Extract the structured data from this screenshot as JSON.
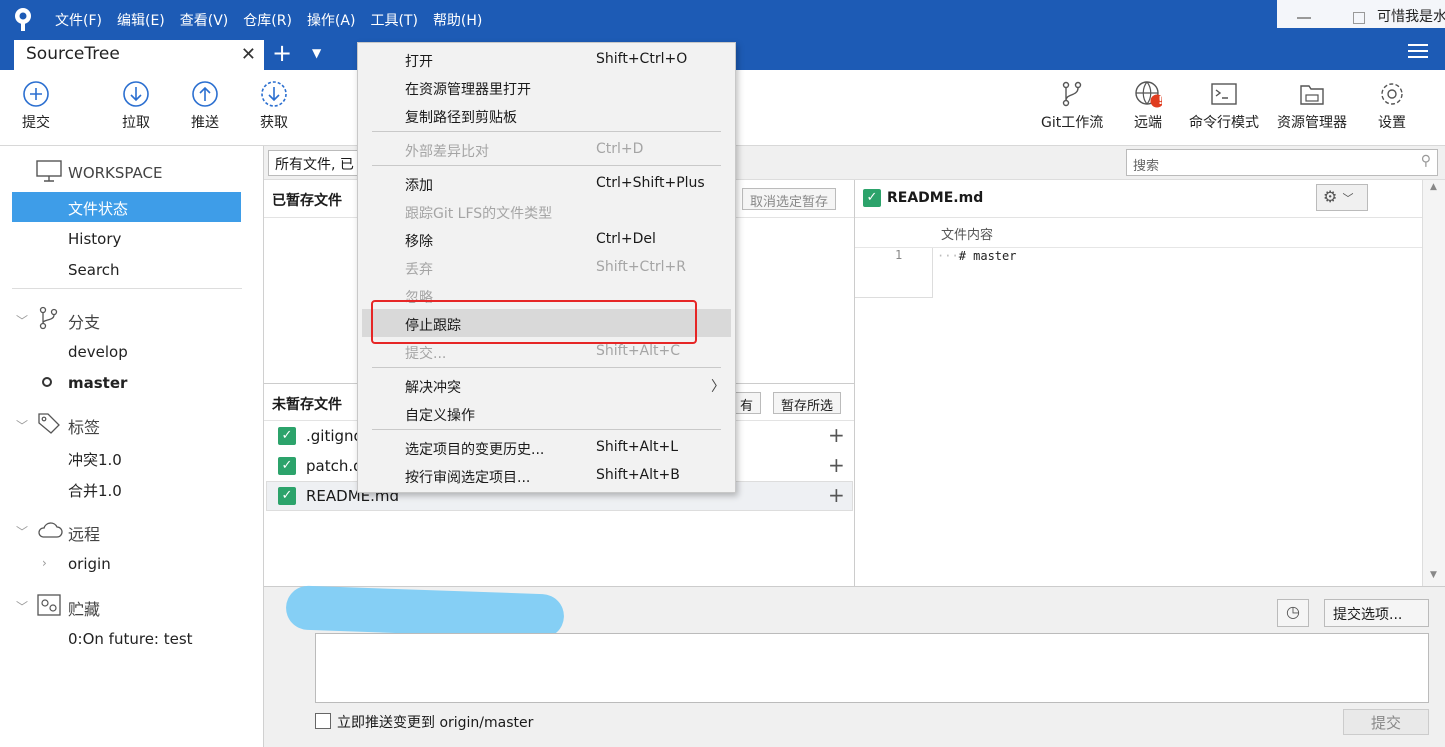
{
  "menubar": {
    "items": [
      "文件(F)",
      "编辑(E)",
      "查看(V)",
      "仓库(R)",
      "操作(A)",
      "工具(T)",
      "帮助(H)"
    ],
    "external_window_title": "可惜我是水"
  },
  "tab": {
    "label": "SourceTree",
    "close": "✕"
  },
  "toolbar": {
    "left": [
      {
        "label": "提交",
        "icon": "plus-circle-icon"
      },
      {
        "label": "拉取",
        "icon": "arrow-down-circle-icon"
      },
      {
        "label": "推送",
        "icon": "arrow-up-circle-icon"
      },
      {
        "label": "获取",
        "icon": "fetch-dashed-circle-icon"
      }
    ],
    "right": [
      {
        "label": "Git工作流",
        "icon": "git-flow-icon"
      },
      {
        "label": "远端",
        "icon": "globe-icon"
      },
      {
        "label": "命令行模式",
        "icon": "terminal-icon"
      },
      {
        "label": "资源管理器",
        "icon": "folder-icon"
      },
      {
        "label": "设置",
        "icon": "gear-icon"
      }
    ],
    "remote_alert": "!"
  },
  "sidebar": {
    "workspace": "WORKSPACE",
    "workspace_items": [
      "文件状态",
      "History",
      "Search"
    ],
    "branches": {
      "title": "分支",
      "items": [
        "develop",
        "master"
      ],
      "current": "master"
    },
    "tags": {
      "title": "标签",
      "items": [
        "冲突1.0",
        "合并1.0"
      ]
    },
    "remotes": {
      "title": "远程",
      "items": [
        "origin"
      ]
    },
    "stashes": {
      "title": "贮藏",
      "items": [
        "0:On future: test"
      ]
    }
  },
  "filter": {
    "dropdown": "所有文件, 已",
    "search_placeholder": "搜索"
  },
  "staged": {
    "title": "已暂存文件",
    "unstage_selected": "取消选定暂存"
  },
  "unstaged": {
    "title": "未暂存文件",
    "stage_all_partial": "有",
    "stage_selected": "暂存所选",
    "files": [
      ".gitignore",
      "patch.d",
      "README.md"
    ]
  },
  "diff": {
    "file": "README.md",
    "subheader": "文件内容",
    "lines": [
      {
        "n": "1",
        "text": "# master"
      }
    ]
  },
  "commit": {
    "options": "提交选项...",
    "push_label": "立即推送变更到 origin/master",
    "commit_button": "提交"
  },
  "context_menu": {
    "items": [
      {
        "label": "打开",
        "shortcut": "Shift+Ctrl+O",
        "disabled": false
      },
      {
        "label": "在资源管理器里打开",
        "shortcut": "",
        "disabled": false
      },
      {
        "label": "复制路径到剪贴板",
        "shortcut": "",
        "disabled": false
      },
      {
        "label": "外部差异比对",
        "shortcut": "Ctrl+D",
        "disabled": true
      },
      {
        "label": "添加",
        "shortcut": "Ctrl+Shift+Plus",
        "disabled": false
      },
      {
        "label": "跟踪Git LFS的文件类型",
        "shortcut": "",
        "disabled": true
      },
      {
        "label": "移除",
        "shortcut": "Ctrl+Del",
        "disabled": false
      },
      {
        "label": "丢弃",
        "shortcut": "Shift+Ctrl+R",
        "disabled": true
      },
      {
        "label": "忽略",
        "shortcut": "",
        "disabled": true
      },
      {
        "label": "停止跟踪",
        "shortcut": "",
        "disabled": false,
        "highlighted": true
      },
      {
        "label": "提交...",
        "shortcut": "Shift+Alt+C",
        "disabled": true
      },
      {
        "label": "解决冲突",
        "shortcut": "",
        "disabled": false,
        "submenu": true
      },
      {
        "label": "自定义操作",
        "shortcut": "",
        "disabled": false
      },
      {
        "label": "选定项目的变更历史...",
        "shortcut": "Shift+Alt+L",
        "disabled": false
      },
      {
        "label": "按行审阅选定项目...",
        "shortcut": "Shift+Alt+B",
        "disabled": false
      }
    ]
  },
  "colors": {
    "accent": "#1d5bb5",
    "selection": "#3e9de8",
    "check": "#2ca36b",
    "highlight_box": "#e62626"
  }
}
